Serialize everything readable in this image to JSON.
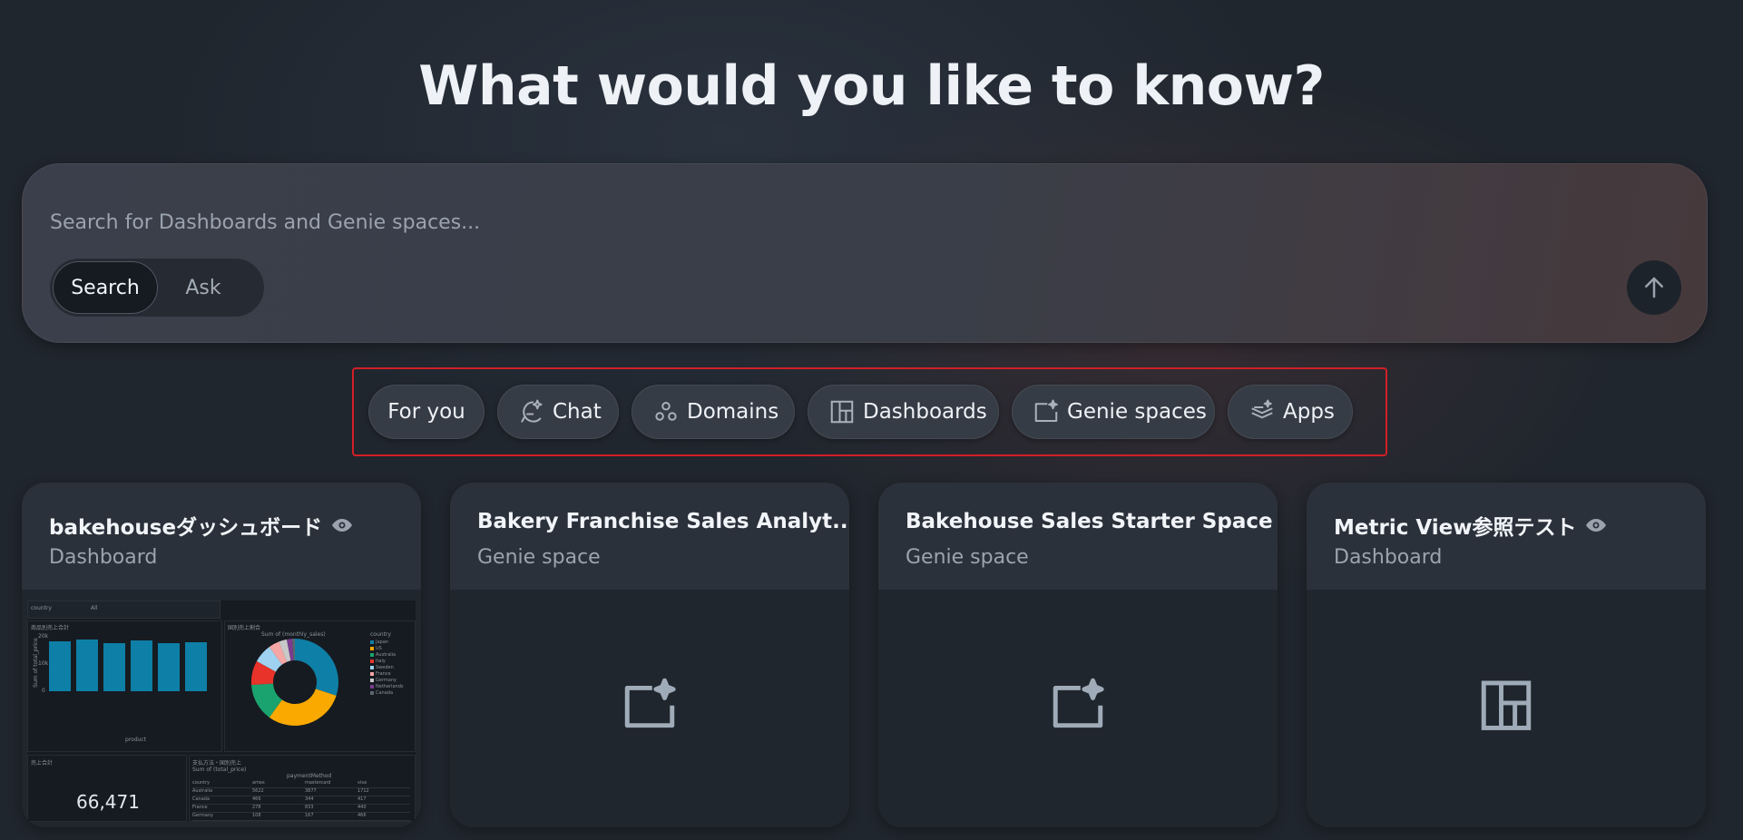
{
  "headline": "What would you like to know?",
  "search": {
    "placeholder": "Search for Dashboards and Genie spaces...",
    "modes": [
      "Search",
      "Ask"
    ],
    "active_mode": "Search",
    "submit_icon": "arrow-up-icon"
  },
  "filters": [
    {
      "label": "For you",
      "icon": null
    },
    {
      "label": "Chat",
      "icon": "chat-sparkle-icon"
    },
    {
      "label": "Domains",
      "icon": "domains-icon"
    },
    {
      "label": "Dashboards",
      "icon": "dashboard-icon"
    },
    {
      "label": "Genie spaces",
      "icon": "genie-space-icon"
    },
    {
      "label": "Apps",
      "icon": "apps-icon"
    }
  ],
  "cards": [
    {
      "title": "bakehouseダッシュボード",
      "type": "Dashboard",
      "preview": "thumbnail"
    },
    {
      "title": "Bakery Franchise Sales Analyt...",
      "type": "Genie space",
      "preview": "genie-space-icon"
    },
    {
      "title": "Bakehouse Sales Starter Space",
      "type": "Genie space",
      "preview": "genie-space-icon"
    },
    {
      "title": "Metric View参照テスト",
      "type": "Dashboard",
      "preview": "dashboard-icon"
    }
  ],
  "thumbnail": {
    "filter_label": "country",
    "filter_value": "All",
    "bar_title": "商品別売上合計",
    "bar_xlabel": "product",
    "bar_ylabel": "Sum of total_price",
    "bar_ticks": [
      "20k",
      "10k",
      "0"
    ],
    "bar_values": [
      0.88,
      0.92,
      0.85,
      0.9,
      0.86,
      0.87
    ],
    "pie_title": "国別売上割合",
    "pie_heading": "Sum of (monthly_sales)",
    "pie_legend_title": "country",
    "pie_legend": [
      "Japan",
      "US",
      "Australia",
      "Italy",
      "Sweden",
      "France",
      "Germany",
      "Netherlands",
      "Canada"
    ],
    "kpi_title": "売上合計",
    "kpi_value": "66,471",
    "table_title": "支払方法・国別売上",
    "table_subtitle": "Sum of (total_price)",
    "table_group": "paymentMethod",
    "table_columns": [
      "country",
      "amex",
      "mastercard",
      "visa"
    ],
    "table_rows": [
      [
        "Australia",
        "5622",
        "3877",
        "1712"
      ],
      [
        "Canada",
        "466",
        "344",
        "417"
      ],
      [
        "France",
        "278",
        "833",
        "440"
      ],
      [
        "Germany",
        "108",
        "167",
        "466"
      ]
    ],
    "colors": {
      "bar": "#0e7fa6",
      "pie": [
        "#0e7fa6",
        "#f9a900",
        "#1aa36f",
        "#e8332a",
        "#9ed2f0",
        "#f7a6a6",
        "#c8c8c8",
        "#7a3b8f",
        "#5c6770"
      ]
    }
  }
}
